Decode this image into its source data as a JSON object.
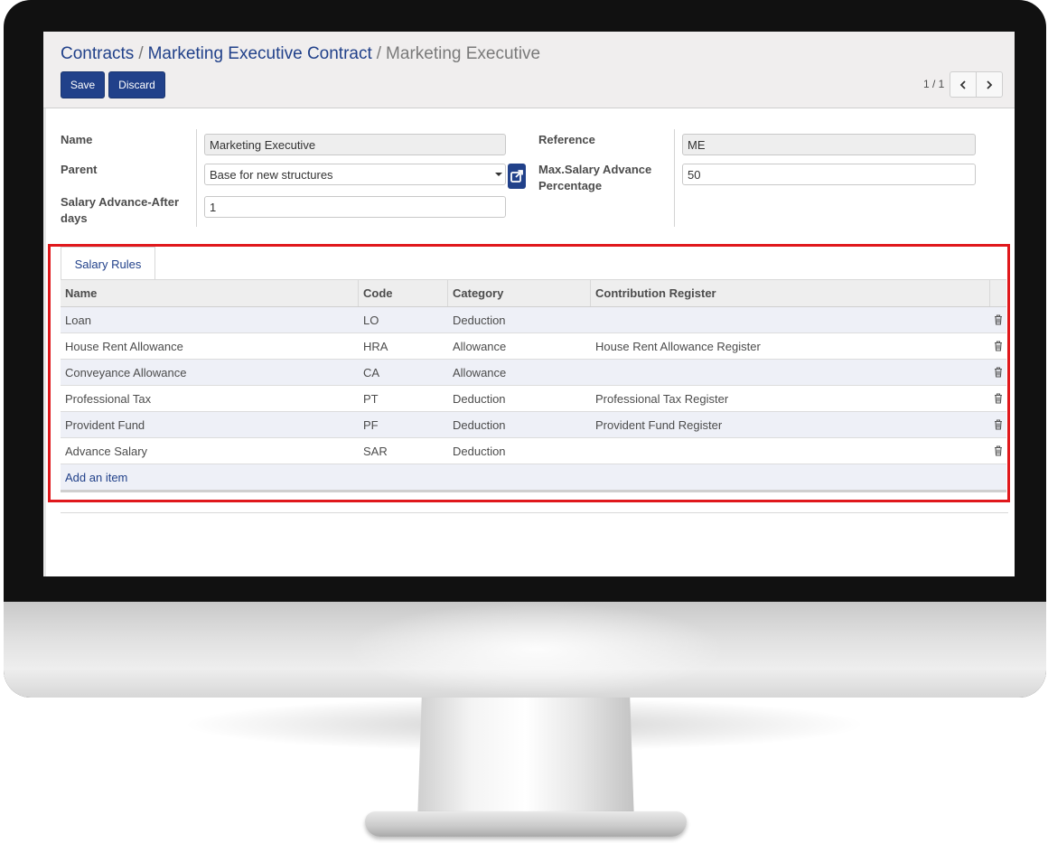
{
  "breadcrumb": {
    "items": [
      "Contracts",
      "Marketing Executive Contract"
    ],
    "separator": "/",
    "current": "Marketing Executive"
  },
  "toolbar": {
    "save_label": "Save",
    "discard_label": "Discard"
  },
  "pager": {
    "value": "1 / 1"
  },
  "form": {
    "name_label": "Name",
    "name_value": "Marketing Executive",
    "parent_label": "Parent",
    "parent_value": "Base for new structures",
    "salary_advance_after_label_1": "Salary Advance-After",
    "salary_advance_after_label_2": "days",
    "salary_advance_after_value": "1",
    "reference_label": "Reference",
    "reference_value": "ME",
    "max_advance_label_1": "Max.Salary Advance",
    "max_advance_label_2": "Percentage",
    "max_advance_value": "50"
  },
  "notebook": {
    "tab_label": "Salary Rules",
    "columns": [
      "Name",
      "Code",
      "Category",
      "Contribution Register"
    ],
    "rows": [
      {
        "name": "Loan",
        "code": "LO",
        "category": "Deduction",
        "register": ""
      },
      {
        "name": "House Rent Allowance",
        "code": "HRA",
        "category": "Allowance",
        "register": "House Rent Allowance Register"
      },
      {
        "name": "Conveyance Allowance",
        "code": "CA",
        "category": "Allowance",
        "register": ""
      },
      {
        "name": "Professional Tax",
        "code": "PT",
        "category": "Deduction",
        "register": "Professional Tax Register"
      },
      {
        "name": "Provident Fund",
        "code": "PF",
        "category": "Deduction",
        "register": "Provident Fund Register"
      },
      {
        "name": "Advance Salary",
        "code": "SAR",
        "category": "Deduction",
        "register": ""
      }
    ],
    "add_item_label": "Add an item"
  },
  "icons": {
    "pager_prev": "chevron-left-icon",
    "pager_next": "chevron-right-icon",
    "external_link": "external-link-icon",
    "delete": "trash-icon",
    "dropdown": "caret-down-icon"
  },
  "colors": {
    "primary": "#21418a",
    "highlight_border": "#e0181c",
    "odd_row": "#eef0f7",
    "control_panel": "#f0eeee"
  }
}
